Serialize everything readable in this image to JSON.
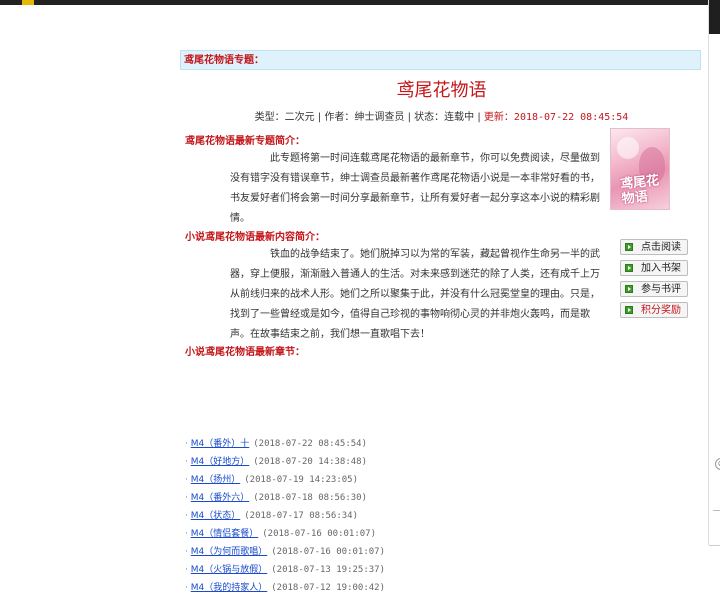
{
  "page": {
    "topic_header": "鸢尾花物语专题：",
    "title": "鸢尾花物语",
    "meta": {
      "type": "类型：二次元",
      "author": "作者：绅士调查员",
      "status": "状态：连载中",
      "update_label": "更新：",
      "update_time": "2018-07-22 08:45:54"
    },
    "intro_label": "鸢尾花物语最新专题简介：",
    "intro_text": "此专题将第一时间连载鸢尾花物语的最新章节，你可以免费阅读，尽量做到没有错字没有错误章节，绅士调查员最新著作鸢尾花物语小说是一本非常好看的书，书友爱好者们将会第一时间分享最新章节，让所有爱好者一起分享这本小说的精彩剧情。",
    "summary_label": "小说鸢尾花物语最新内容简介：",
    "summary_text": "铁血的战争结束了。她们脱掉习以为常的军装，藏起曾视作生命另一半的武器，穿上便服，渐渐融入普通人的生活。对未来感到迷茫的除了人类，还有成千上万从前线归来的战术人形。她们之所以聚集于此，并没有什么冠冕堂皇的理由。只是，找到了一些曾经或是如今，值得自己珍视的事物响彻心灵的并非炮火轰鸣，而是歌声。在故事结束之前，我们想一直歌唱下去！",
    "latest_label": "小说鸢尾花物语最新章节：",
    "cover_text": "鸢尾花物语"
  },
  "buttons": {
    "read": "点击阅读",
    "add_shelf": "加入书架",
    "review": "参与书评",
    "points": "积分奖励"
  },
  "chapters": [
    {
      "title": "M4（番外）十",
      "time": "(2018-07-22 08:45:54)"
    },
    {
      "title": "M4（好地方）",
      "time": "(2018-07-20 14:38:48)"
    },
    {
      "title": "M4（扬州）",
      "time": "(2018-07-19 14:23:05)"
    },
    {
      "title": "M4（番外六）",
      "time": "(2018-07-18 08:56:30)"
    },
    {
      "title": "M4（状态）",
      "time": "(2018-07-17 08:56:34)"
    },
    {
      "title": "M4（情侣套餐）",
      "time": "(2018-07-16 00:01:07)"
    },
    {
      "title": "M4（为何而歌唱）",
      "time": "(2018-07-16 00:01:07)"
    },
    {
      "title": "M4（火锅与放假）",
      "time": "(2018-07-13 19:25:37)"
    },
    {
      "title": "M4（我的持家人）",
      "time": "(2018-07-12 19:00:42)"
    }
  ],
  "colors": {
    "accent_red": "#c3171b",
    "header_bg": "#dff2fb",
    "link_blue": "#1a4bcc",
    "icon_green": "#3e9b2a"
  }
}
